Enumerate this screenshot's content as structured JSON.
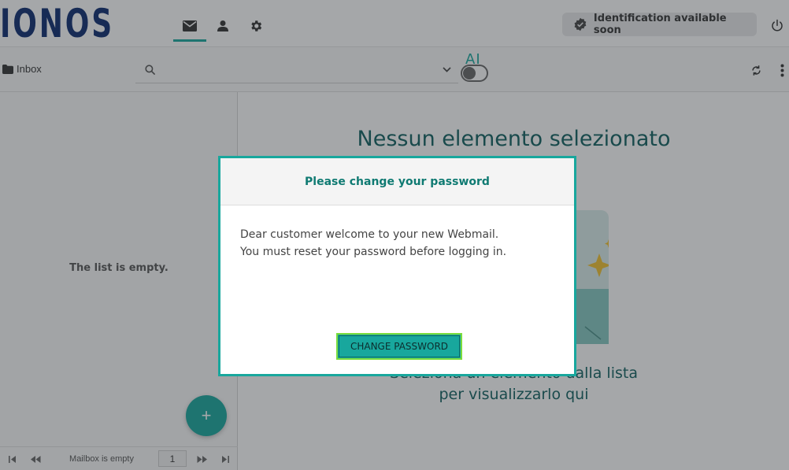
{
  "header": {
    "logo_text": "IONOS",
    "nav": [
      {
        "name": "mail",
        "icon": "mail-icon",
        "active": true
      },
      {
        "name": "contacts",
        "icon": "person-icon",
        "active": false
      },
      {
        "name": "settings",
        "icon": "gear-icon",
        "active": false
      }
    ],
    "identification_label": "Identification available soon",
    "power_icon": "power-icon"
  },
  "toolbar": {
    "folder_label": "Inbox",
    "search_placeholder": "",
    "ai_label": "AI",
    "ai_toggle_on": false
  },
  "list": {
    "empty_text": "The list is empty.",
    "fab_label": "+",
    "pager": {
      "status": "Mailbox is empty",
      "page": "1"
    }
  },
  "content": {
    "title": "Nessun elemento selezionato",
    "subtitle_line1": "Seleziona un elemento dalla lista",
    "subtitle_line2": "per visualizzarlo qui"
  },
  "dialog": {
    "title": "Please change your password",
    "body_line1": "Dear customer welcome to your new Webmail.",
    "body_line2": "You must reset your password before logging in.",
    "button_label": "CHANGE PASSWORD"
  },
  "colors": {
    "accent": "#18a79d",
    "brand": "#0b2a6f",
    "dialog_title": "#0f7a72",
    "button_focus": "#7bdc3c"
  }
}
